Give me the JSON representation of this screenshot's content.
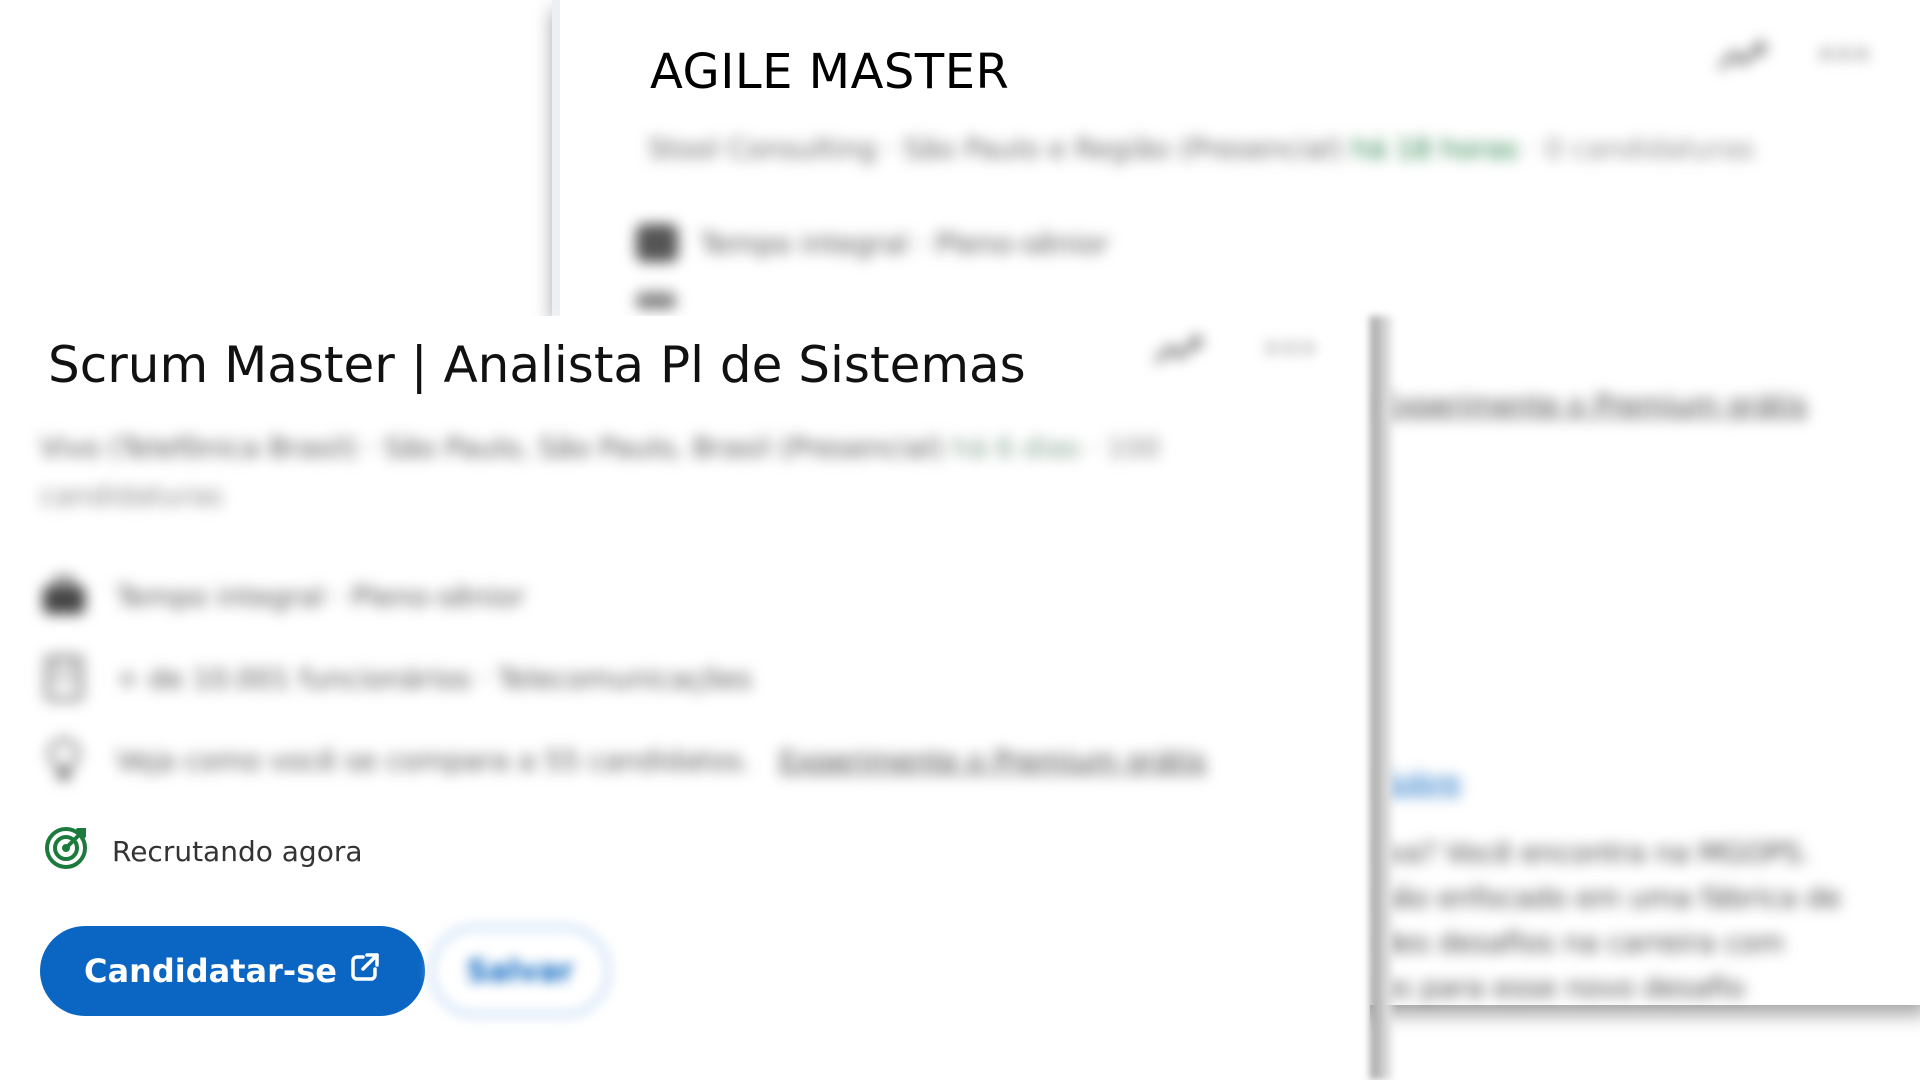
{
  "background_job": {
    "title": "AGILE MASTER",
    "company": "Stool Consulting",
    "location": "São Paulo e Região (Presencial)",
    "posted": "há 18 horas",
    "applicants": "0 candidaturas",
    "employment": "Tempo integral · Pleno-sênior",
    "premium_link": "Experimente o Premium grátis",
    "section_heading": "Sobre",
    "description_lines": [
      "iva? Você encontra na MGOPS.",
      "são enfocado em uma fábrica de",
      "des desafios na carreira com",
      "es para esse novo desafio"
    ]
  },
  "foreground_job": {
    "title": "Scrum Master | Analista Pl de Sistemas",
    "company": "Vivo (Telefônica Brasil)",
    "location": "São Paulo, São Paulo, Brasil (Presencial)",
    "posted": "há 6 dias",
    "applicants": "100 candidaturas",
    "employment": "Tempo integral · Pleno-sênior",
    "company_size": "+ de 10.001 funcionários · Telecomunicações",
    "compare_text": "Veja como você se compara a 55 candidatos.",
    "premium_link": "Experimente o Premium grátis",
    "hiring_status": "Recrutando agora",
    "apply_label": "Candidatar-se",
    "save_label": "Salvar"
  },
  "colors": {
    "accent": "#0a66c2",
    "hiring_green": "#1c7a3c"
  },
  "icons": {
    "share": "share-icon",
    "more": "more-icon",
    "briefcase": "briefcase-icon",
    "building": "building-icon",
    "lightbulb": "lightbulb-icon",
    "target": "target-icon",
    "external": "external-link-icon"
  }
}
